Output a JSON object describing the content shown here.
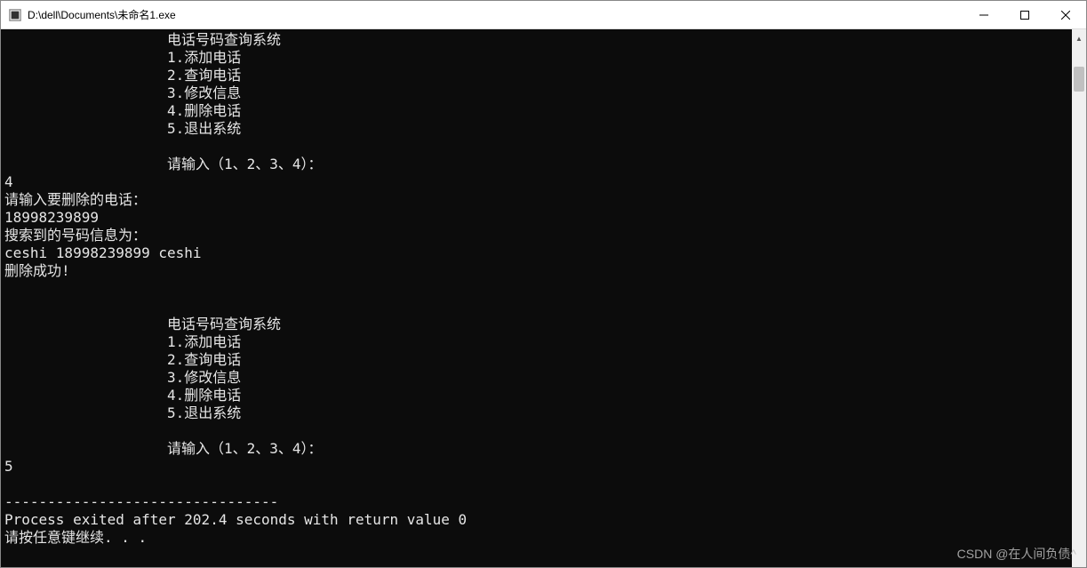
{
  "window": {
    "title": "D:\\dell\\Documents\\未命名1.exe"
  },
  "menu": {
    "title": "电话号码查询系统",
    "items": [
      "1.添加电话",
      "2.查询电话",
      "3.修改信息",
      "4.删除电话",
      "5.退出系统"
    ],
    "prompt": "请输入（1、2、3、4）："
  },
  "session1": {
    "choice": "4",
    "del_prompt": "请输入要删除的电话：",
    "del_phone": "18998239899",
    "found_label": "搜索到的号码信息为：",
    "found_record": "ceshi 18998239899 ceshi",
    "del_success": "删除成功!"
  },
  "session2": {
    "choice": "5"
  },
  "exit": {
    "sep": "--------------------------------",
    "line1": "Process exited after 202.4 seconds with return value 0",
    "line2": "请按任意键继续. . ."
  },
  "watermark": "CSDN @在人间负债^"
}
